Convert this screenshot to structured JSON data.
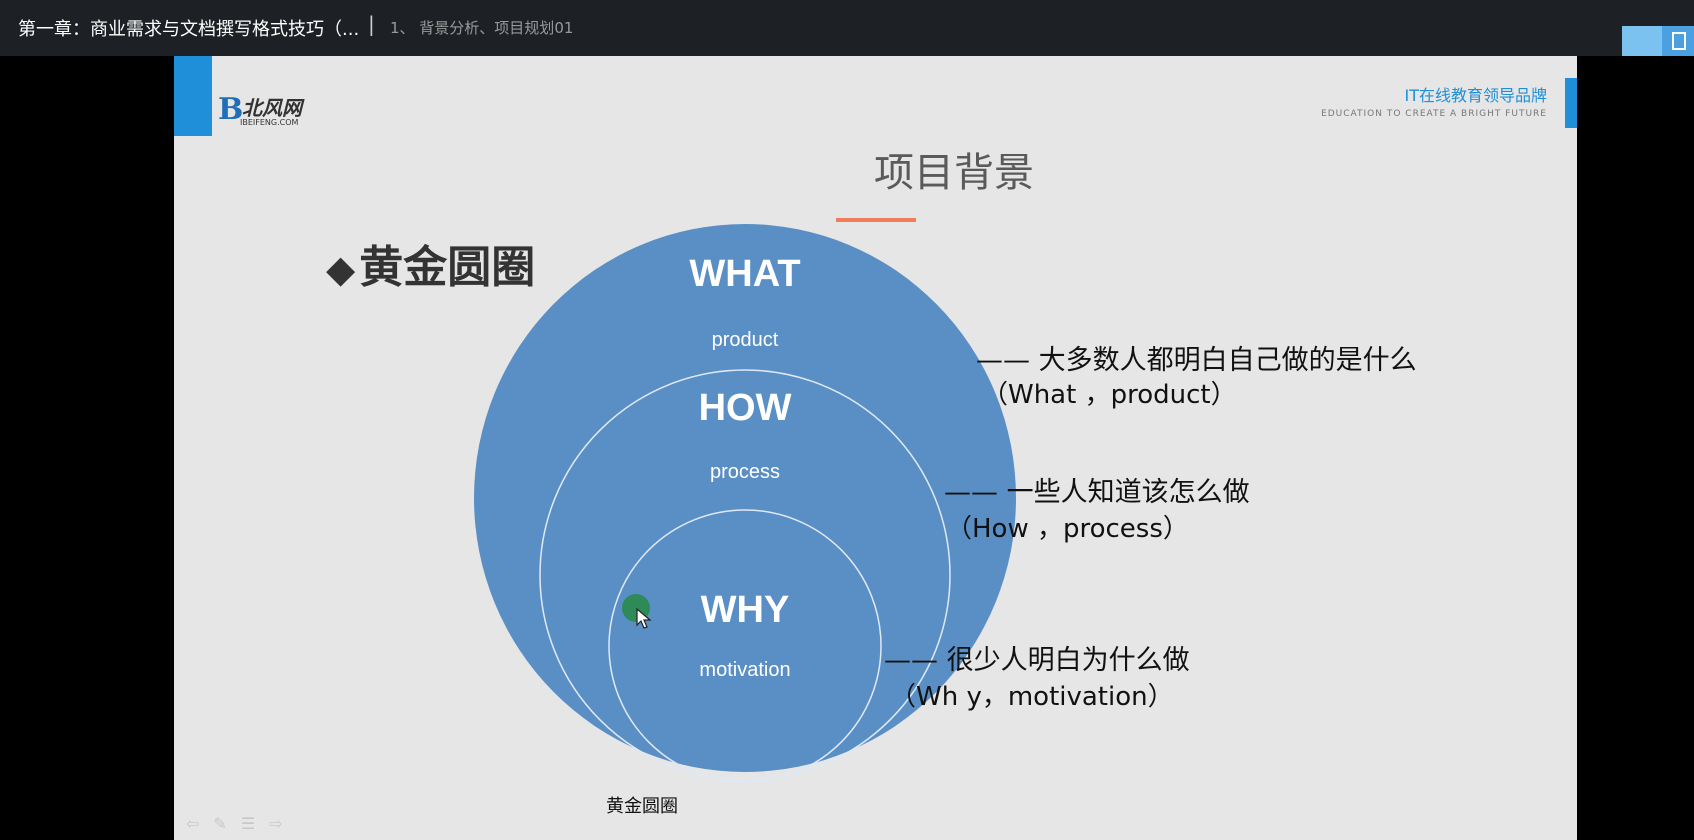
{
  "header": {
    "course_title": "第一章：商业需求与文档撰写格式技巧（...",
    "separator": "|",
    "lesson_title": "1、 背景分析、项目规划01"
  },
  "slide": {
    "logo": {
      "mark": "B",
      "name": "北风网",
      "url": "IBEIFENG.COM"
    },
    "brand_cn": "IT在线教育领导品牌",
    "brand_en": "EDUCATION TO CREATE A BRIGHT FUTURE",
    "title": "项目背景",
    "heading": "黄金圆圈",
    "heading_bullet": "◆",
    "circles": {
      "what": {
        "label": "WHAT",
        "sub": "product"
      },
      "how": {
        "label": "HOW",
        "sub": "process"
      },
      "why": {
        "label": "WHY",
        "sub": "motivation"
      }
    },
    "explanations": [
      {
        "line": "——  大多数人都明白自己做的是什么",
        "sub": "（What ，product）"
      },
      {
        "line": "——  一些人知道该怎么做",
        "sub": "（How ，process）"
      },
      {
        "line": "——  很少人明白为什么做",
        "sub": "（Wh y，motivation）"
      }
    ],
    "caption": "黄金圆圈"
  },
  "colors": {
    "circle_fill": "#5a8fc6",
    "accent_blue": "#1e8fd8",
    "underline": "#f07c5c"
  },
  "icons": [
    "cursor-icon",
    "pen-icon",
    "menu-icon",
    "back-icon",
    "forward-icon"
  ]
}
